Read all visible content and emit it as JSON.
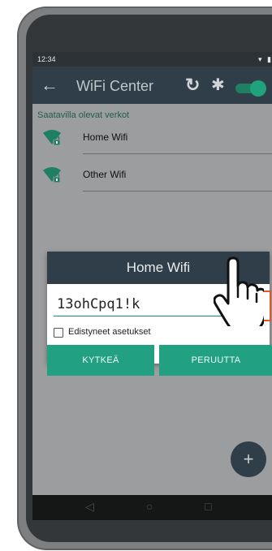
{
  "status_bar": {
    "time": "12:34",
    "icons": "▾ ▮"
  },
  "app_bar": {
    "back_icon": "←",
    "title": "WiFi Center",
    "refresh_icon": "↻",
    "settings_icon": "✱",
    "toggle_on": true
  },
  "networks": {
    "section_title": "Saatavilla olevat verkot",
    "items": [
      {
        "label": "Home Wifi",
        "icon": "wifi-lock-icon"
      },
      {
        "label": "Other Wifi",
        "icon": "wifi-lock-icon"
      }
    ]
  },
  "dialog": {
    "title": "Home Wifi",
    "password_value": "13ohCpq1!k",
    "advanced_label": "Edistyneet asetukset",
    "advanced_checked": false,
    "connect_label": "KYTKEÄ",
    "cancel_label": "PERUUTTA"
  },
  "fab": {
    "label": "+"
  },
  "nav": {
    "back": "◁",
    "home": "○",
    "recent": "□"
  },
  "colors": {
    "accent": "#21a181",
    "app_bar": "#2f3e48",
    "highlight": "#e05a2a",
    "section_title": "#1e5e4d"
  }
}
